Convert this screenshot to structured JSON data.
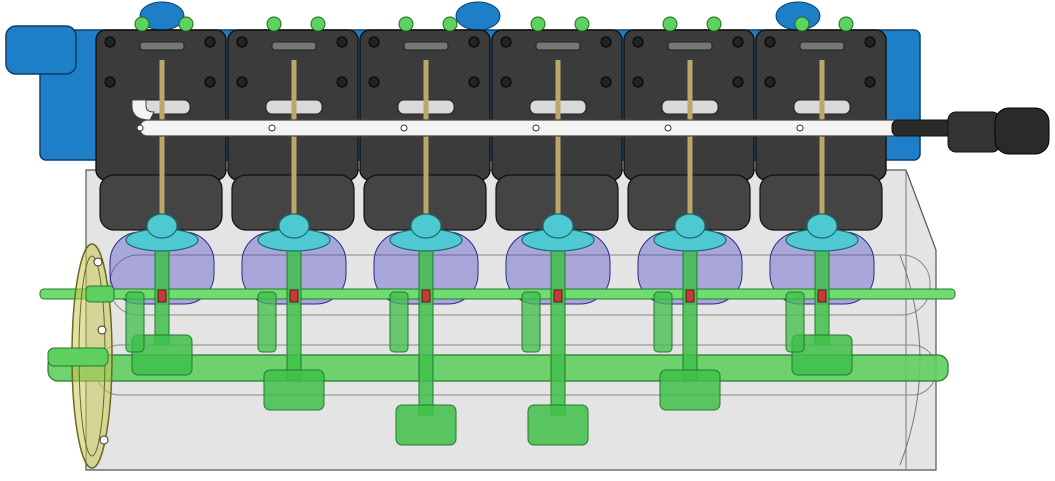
{
  "image": {
    "subject": "engine-cad-model",
    "colors": {
      "background": "#ffffff",
      "frame_blue": "#1e7fc8",
      "frame_blue_dark": "#0f5d9c",
      "cylinder_block": "#3b3b3b",
      "cylinder_block_edge": "#111111",
      "valve_gear_green": "#5fd35f",
      "pushrod": "#b9a86a",
      "manifold_white": "#f2f2f2",
      "manifold_dark": "#2a2a2a",
      "rocker_cap_cyan": "#4fc9d1",
      "piston_blue": "#3b36c8",
      "crank_green": "#3fbf4a",
      "crank_green_dark": "#237a2b",
      "crankcase_gray": "#b8b8b8",
      "flywheel_olive": "#b5b34a"
    },
    "cylinder_count": 6
  }
}
